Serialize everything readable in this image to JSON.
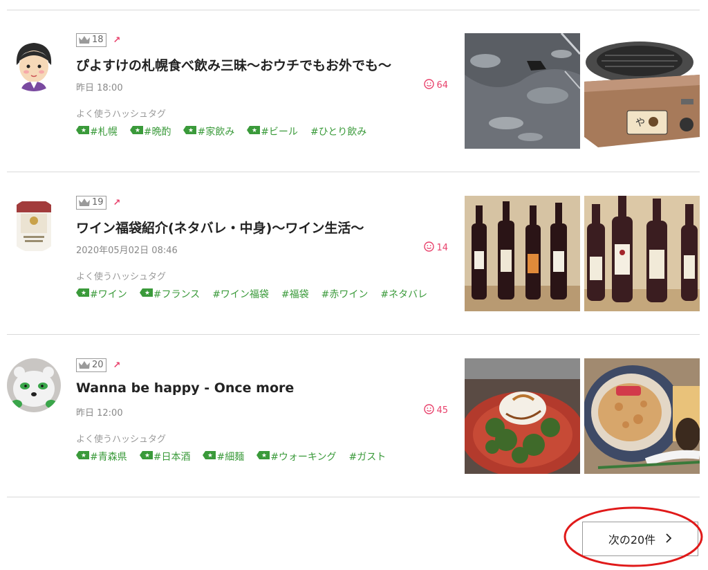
{
  "entries": [
    {
      "rank": "18",
      "title": "ぴよすけの札幌食べ飲み三昧～おウチでもお外でも～",
      "date": "昨日 18:00",
      "likes": "64",
      "tags_label": "よく使うハッシュタグ",
      "tags": [
        {
          "text": "#札幌",
          "icon": true
        },
        {
          "text": "#晩酌",
          "icon": true
        },
        {
          "text": "#家飲み",
          "icon": true
        },
        {
          "text": "#ビール",
          "icon": true
        },
        {
          "text": "#ひとり飲み",
          "icon": false
        }
      ]
    },
    {
      "rank": "19",
      "title": "ワイン福袋紹介(ネタバレ・中身)～ワイン生活～",
      "date": "2020年05月02日 08:46",
      "likes": "14",
      "tags_label": "よく使うハッシュタグ",
      "tags": [
        {
          "text": "#ワイン",
          "icon": true
        },
        {
          "text": "#フランス",
          "icon": true
        },
        {
          "text": "#ワイン福袋",
          "icon": false
        },
        {
          "text": "#福袋",
          "icon": false
        },
        {
          "text": "#赤ワイン",
          "icon": false
        },
        {
          "text": "#ネタバレ",
          "icon": false
        }
      ]
    },
    {
      "rank": "20",
      "title": "Wanna be happy - Once more",
      "date": "昨日 12:00",
      "likes": "45",
      "tags_label": "よく使うハッシュタグ",
      "tags": [
        {
          "text": "#青森県",
          "icon": true
        },
        {
          "text": "#日本酒",
          "icon": true
        },
        {
          "text": "#細麺",
          "icon": true
        },
        {
          "text": "#ウォーキング",
          "icon": true
        },
        {
          "text": "#ガスト",
          "icon": false
        }
      ]
    }
  ],
  "pagination": {
    "next_label": "次の20件"
  },
  "colors": {
    "accent": "#e8416b",
    "tag": "#3a9a3a",
    "annotation": "#e01a1a"
  },
  "icons": [
    "crown-icon",
    "trend-up-icon",
    "smile-icon",
    "tag-icon",
    "chevron-right-icon"
  ]
}
